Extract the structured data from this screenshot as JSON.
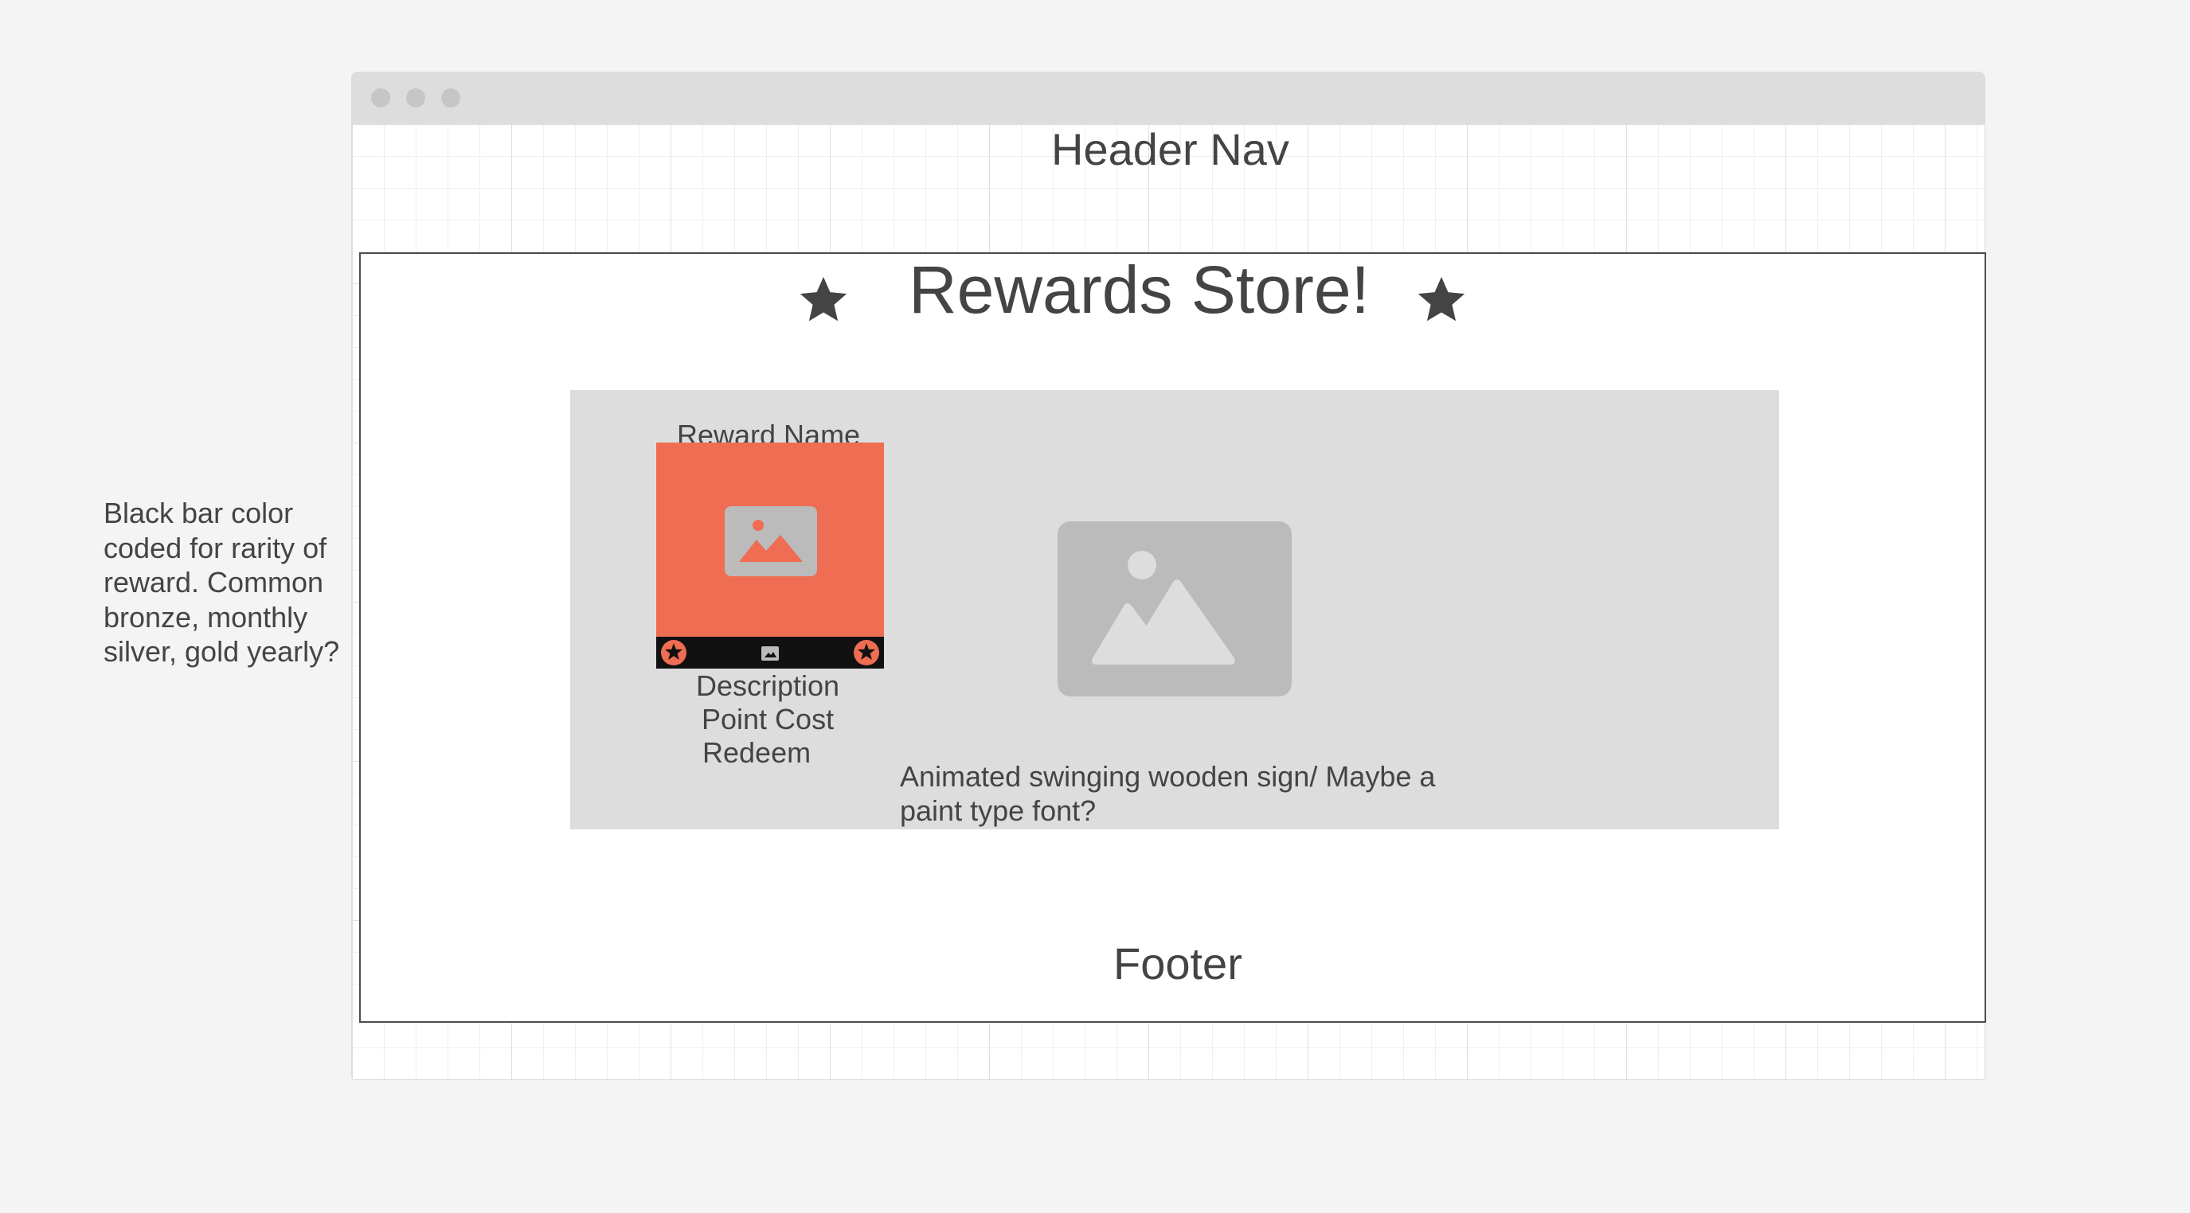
{
  "header": {
    "nav_label": "Header Nav"
  },
  "store": {
    "title": "Rewards Store!"
  },
  "reward_card": {
    "name": "Reward Name",
    "description": "Description",
    "point_cost": "Point Cost",
    "redeem": "Redeem"
  },
  "notes": {
    "sign": "Animated swinging wooden sign/ Maybe a paint type font?",
    "rarity": "Black bar color coded for rarity of reward. Common bronze, monthly silver, gold yearly?"
  },
  "footer": {
    "label": "Footer"
  },
  "colors": {
    "card_accent": "#ef6d52",
    "rarity_bar": "#111111",
    "placeholder_gray": "#bbbbbb",
    "panel_gray": "#dddddd"
  },
  "icons": {
    "title_left": "star-icon",
    "title_right": "star-icon",
    "card_image": "image-placeholder-icon",
    "sign_image": "image-placeholder-icon"
  }
}
